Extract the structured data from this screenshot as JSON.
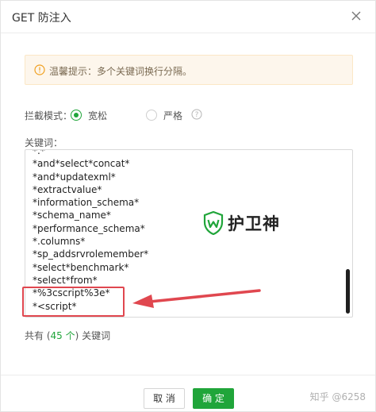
{
  "dialog": {
    "title": "GET 防注入"
  },
  "tip": {
    "text": "温馨提示：多个关键词换行分隔。"
  },
  "mode": {
    "label": "拦截模式：",
    "options": [
      {
        "label": "宽松",
        "checked": true
      },
      {
        "label": "严格",
        "checked": false
      }
    ]
  },
  "keywords": {
    "label": "关键词：",
    "items": [
      "*.*",
      "*and*select*concat*",
      "*and*updatexml*",
      "*extractvalue*",
      "*information_schema*",
      "*schema_name*",
      "*performance_schema*",
      "*.columns*",
      "*sp_addsrvrolemember*",
      "*select*benchmark*",
      "*select*from*",
      "*%3cscript%3e*",
      "*<script*"
    ]
  },
  "count": {
    "prefix": "共有 (",
    "value": "45",
    "unit": " 个",
    "suffix": ") 关键词"
  },
  "watermark": {
    "text": "护卫神"
  },
  "footer": {
    "cancel": "取 消",
    "ok": "确 定",
    "credit": "知乎 @6258"
  },
  "colors": {
    "accent": "#20a53a",
    "highlight": "#e0474f",
    "tip_bg": "#fdf6ec"
  }
}
